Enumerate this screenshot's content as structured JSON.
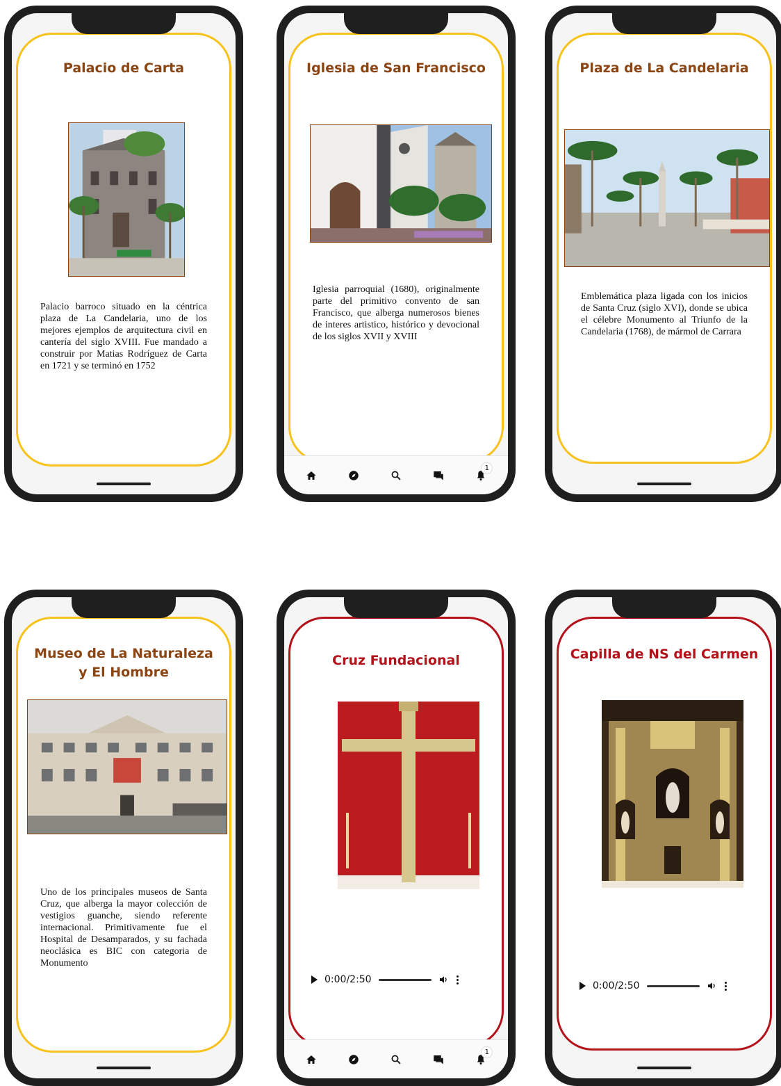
{
  "screens": [
    {
      "title": "Palacio de Carta",
      "description": "Palacio barroco situado en la céntrica plaza de La Candelaria, uno de los mejores ejemplos de arquitectura civil en cantería del siglo XVIII. Fue mandado a construir por Matias Rodríguez de Carta en 1721 y se terminó en 1752",
      "border_color": "#f6c21b"
    },
    {
      "title": "Iglesia de San Francisco",
      "description": "Iglesia parroquial (1680), originalmente parte del primitivo convento de san Francisco, que alberga numerosos bienes de interes artistico, histórico y devocional de los siglos XVII y XVIII",
      "border_color": "#f6c21b"
    },
    {
      "title": "Plaza de La Candelaria",
      "description": "Emblemática plaza ligada con los inicios de Santa Cruz (siglo XVI), donde se ubica el célebre Monumento al Triunfo de la Candelaria (1768), de mármol de Carrara",
      "border_color": "#f6c21b"
    },
    {
      "title": "Museo de La Naturaleza y El Hombre",
      "description": "Uno de los principales museos de Santa Cruz, que alberga la mayor colección de vestigios guanche, siendo referente internacional. Primitivamente fue el Hospital de Desamparados, y su fachada neoclásica es BIC con categoria de Monumento",
      "border_color": "#f6c21b"
    },
    {
      "title": "Cruz Fundacional",
      "audio_time": "0:00/2:50",
      "border_color": "#b3121a"
    },
    {
      "title": "Capilla de NS del Carmen",
      "audio_time": "0:00/2:50",
      "border_color": "#b3121a"
    }
  ],
  "navbar": {
    "items": [
      "home-icon",
      "explore-icon",
      "search-icon",
      "chat-icon",
      "notifications-icon"
    ],
    "notification_count": "1"
  },
  "colors": {
    "frame": "#1f1f1f",
    "gold": "#f6c21b",
    "red": "#b3121a",
    "title_brown": "#8b4513"
  }
}
